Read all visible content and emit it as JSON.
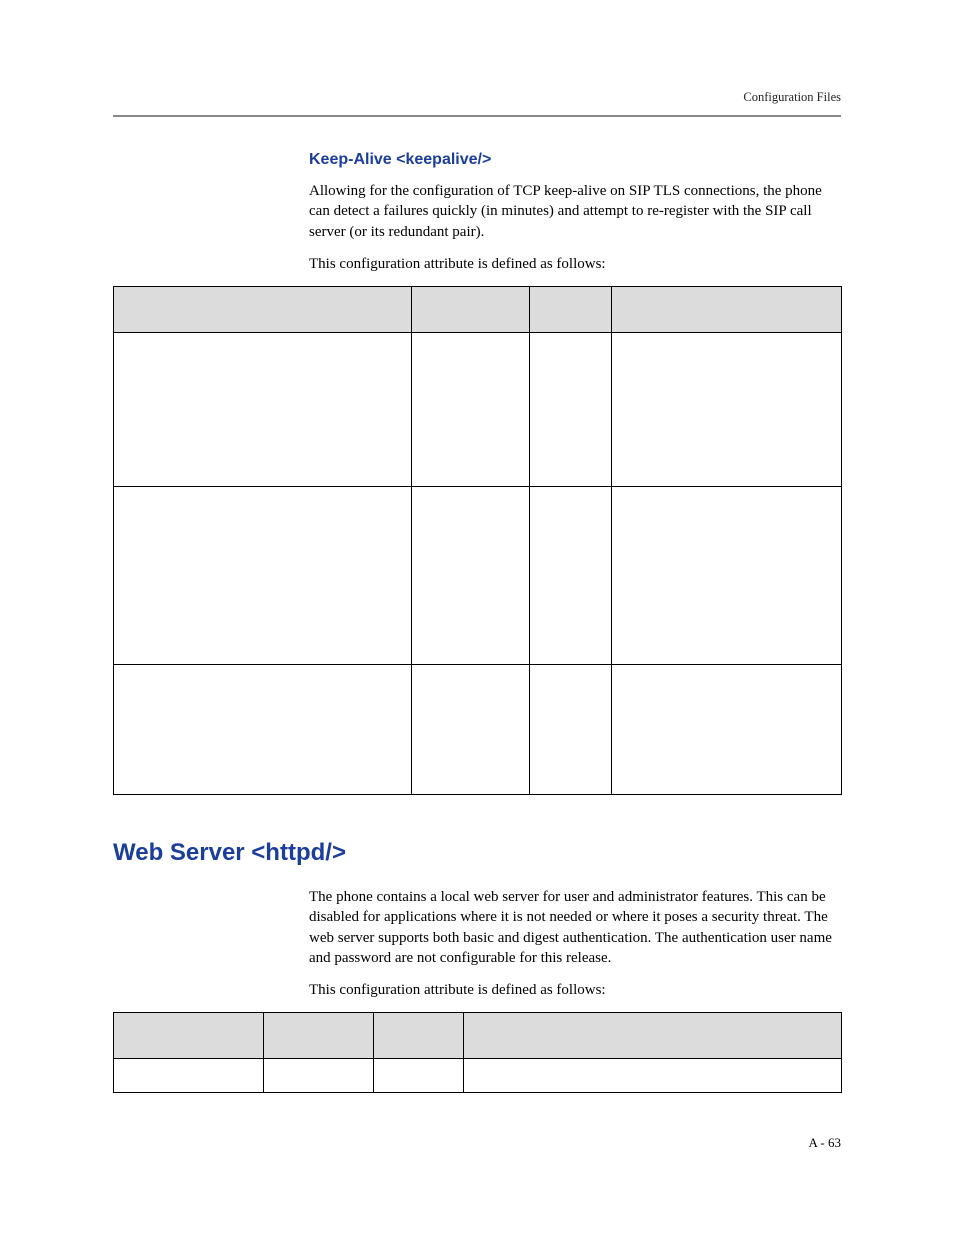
{
  "running_head": "Configuration Files",
  "keepalive": {
    "heading": "Keep-Alive <keepalive/>",
    "para1": "Allowing for the configuration of TCP keep-alive on SIP TLS connections, the phone can detect a failures quickly (in minutes) and attempt to re-register with the SIP call server (or its redundant pair).",
    "para2": "This configuration attribute is defined as follows:"
  },
  "httpd": {
    "heading": "Web Server <httpd/>",
    "para1": "The phone contains a local web server for user and administrator features. This can be disabled for applications where it is not needed or where it poses a security threat. The web server supports both basic and digest authentication. The authentication user name and password are not configurable for this release.",
    "para2": "This configuration attribute is defined as follows:"
  },
  "page_number": "A - 63"
}
